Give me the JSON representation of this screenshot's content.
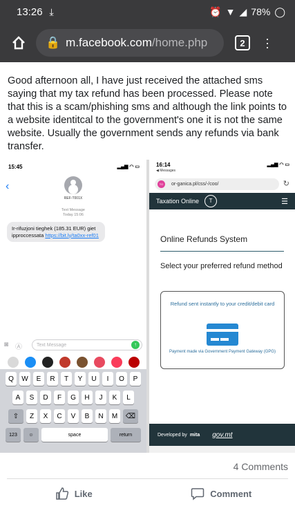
{
  "status_bar": {
    "time": "13:26",
    "battery": "78%"
  },
  "browser": {
    "url_domain": "m.facebook.com",
    "url_path": "/home.php",
    "tab_count": "2"
  },
  "post": {
    "text": "Good afternoon all, I have just received the attached sms saying that my tax refund has been processed. Please note that this is a scam/phishing sms and although the link points to a website identitcal to the government's one it is not the same website. Usually the government sends any refunds via bank transfer.",
    "comments_count": "4 Comments",
    "like_label": "Like",
    "comment_label": "Comment"
  },
  "sms_screen": {
    "time": "15:45",
    "contact": "REF-T001X",
    "header_line1": "Text Message",
    "header_line2": "Today 15:06",
    "message_text": "Ir-rifuzjoni tieghek (185.31 EUR) giet ipproccessata ",
    "message_link": "https://bit.ly/ta0xx-ref01",
    "input_placeholder": "Text Message",
    "keyboard_row1": [
      "Q",
      "W",
      "E",
      "R",
      "T",
      "Y",
      "U",
      "I",
      "O",
      "P"
    ],
    "keyboard_row2": [
      "A",
      "S",
      "D",
      "F",
      "G",
      "H",
      "J",
      "K",
      "L"
    ],
    "keyboard_row3": [
      "Z",
      "X",
      "C",
      "V",
      "B",
      "N",
      "M"
    ],
    "key_123": "123",
    "key_space": "space",
    "key_return": "return"
  },
  "web_screen": {
    "time": "16:14",
    "back_label": "◀ Messages",
    "url": "or-ganica.pl/css/-/coo/",
    "nav_title": "Taxation Online",
    "page_title": "Online Refunds System",
    "select_label": "Select your preferred refund method",
    "card_title": "Refund sent instantly to your credit/debit card",
    "card_subtitle": "Payment made via Government Payment Gateway (GPG)",
    "footer_text": "Developed by",
    "footer_brand": "mita",
    "footer_gov": "gov.mt"
  }
}
